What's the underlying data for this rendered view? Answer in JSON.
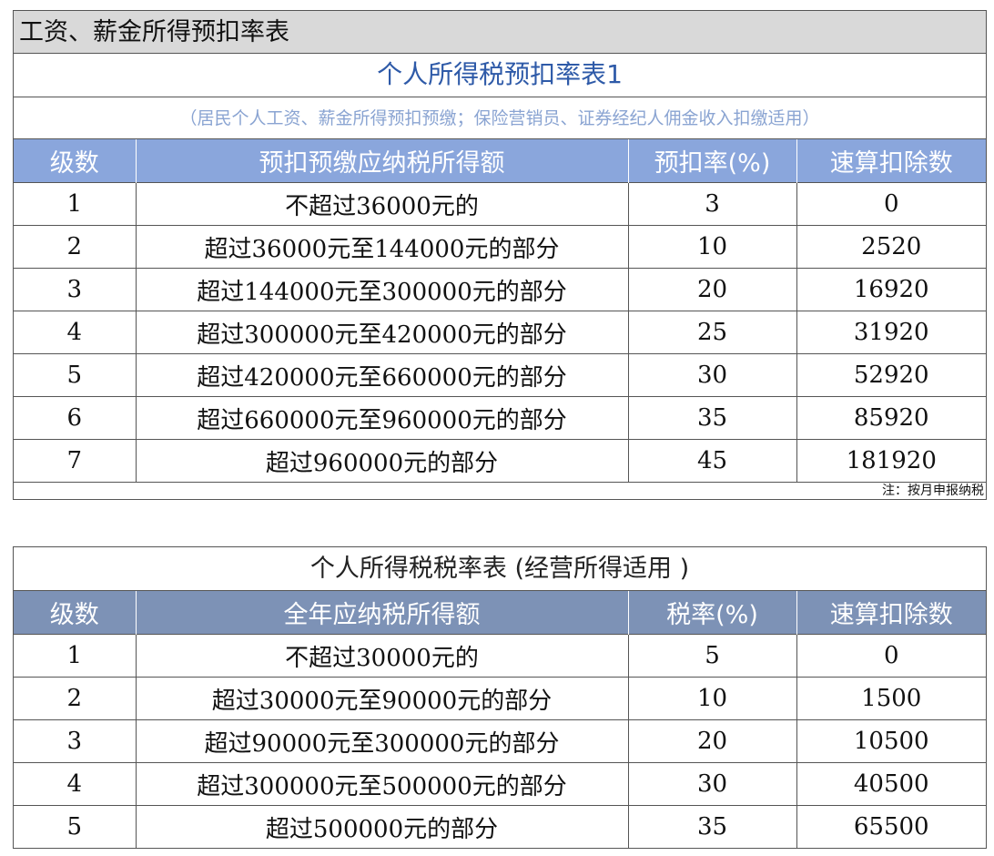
{
  "sheet_title": "工资、薪金所得预扣率表",
  "table1": {
    "title": "个人所得税预扣率表1",
    "subtitle": "（居民个人工资、薪金所得预扣预缴；保险营销员、证券经纪人佣金收入扣缴适用）",
    "headers": [
      "级数",
      "预扣预缴应纳税所得额",
      "预扣率(%)",
      "速算扣除数"
    ],
    "rows": [
      [
        "1",
        "不超过36000元的",
        "3",
        "0"
      ],
      [
        "2",
        "超过36000元至144000元的部分",
        "10",
        "2520"
      ],
      [
        "3",
        "超过144000元至300000元的部分",
        "20",
        "16920"
      ],
      [
        "4",
        "超过300000元至420000元的部分",
        "25",
        "31920"
      ],
      [
        "5",
        "超过420000元至660000元的部分",
        "30",
        "52920"
      ],
      [
        "6",
        "超过660000元至960000元的部分",
        "35",
        "85920"
      ],
      [
        "7",
        "超过960000元的部分",
        "45",
        "181920"
      ]
    ],
    "note": "注：按月申报纳税"
  },
  "table2": {
    "title": "个人所得税税率表 (经营所得适用 )",
    "headers": [
      "级数",
      "全年应纳税所得额",
      "税率(%)",
      "速算扣除数"
    ],
    "rows": [
      [
        "1",
        "不超过30000元的",
        "5",
        "0"
      ],
      [
        "2",
        "超过30000元至90000元的部分",
        "10",
        "1500"
      ],
      [
        "3",
        "超过90000元至300000元的部分",
        "20",
        "10500"
      ],
      [
        "4",
        "超过300000元至500000元的部分",
        "30",
        "40500"
      ],
      [
        "5",
        "超过500000元的部分",
        "35",
        "65500"
      ]
    ]
  },
  "colors": {
    "sheet_title_bg": "#d9d9d9",
    "table1_title_text": "#2e5aa8",
    "table1_subtitle_text": "#8aa4d2",
    "table1_header_bg": "#8aa6dc",
    "table2_header_bg": "#7d92b6",
    "header_text": "#ffffff"
  }
}
